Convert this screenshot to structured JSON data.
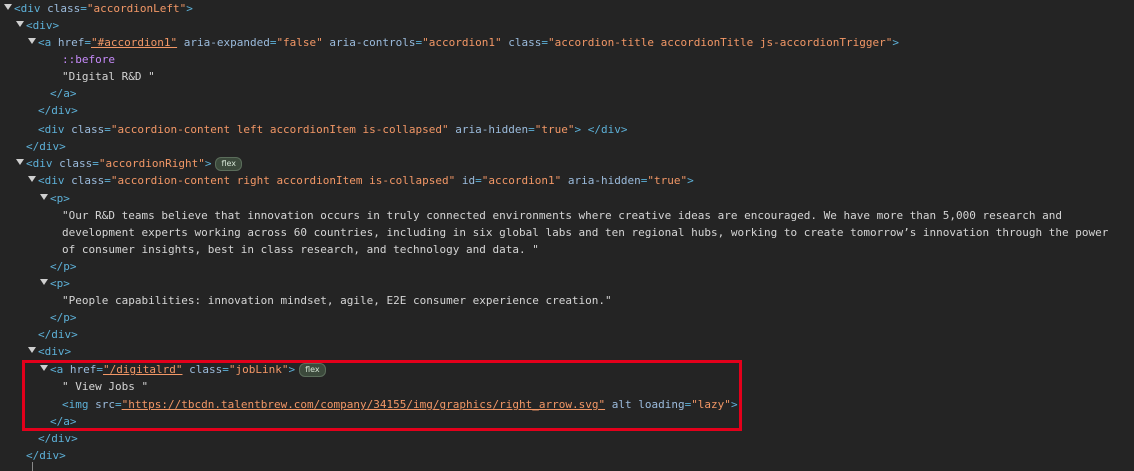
{
  "lines": {
    "l0": {
      "tag_open": "<div ",
      "a1": "class",
      "eq": "=",
      "v1": "\"accordionLeft\"",
      "close": ">"
    },
    "l1": {
      "text": "<div>"
    },
    "l2": {
      "tag_open": "<a ",
      "a1": "href",
      "v1": "\"#accordion1\"",
      "a2": "aria-expanded",
      "v2": "\"false\"",
      "a3": "aria-controls",
      "v3": "\"accordion1\"",
      "a4": "class",
      "v4": "\"accordion-title accordionTitle js-accordionTrigger\"",
      "close": ">"
    },
    "l3": {
      "text": "::before"
    },
    "l4": {
      "text": "\"Digital R&D \""
    },
    "l5": {
      "text": "</a>"
    },
    "l6": {
      "text": "</div>"
    },
    "l7": {
      "tag_open": "<div ",
      "a1": "class",
      "v1": "\"accordion-content left accordionItem is-collapsed\"",
      "a2": "aria-hidden",
      "v2": "\"true\"",
      "close": "> </div>"
    },
    "l8": {
      "text": "</div>"
    },
    "l9": {
      "tag_open": "<div ",
      "a1": "class",
      "v1": "\"accordionRight\"",
      "close": ">",
      "badge": "flex"
    },
    "l10": {
      "tag_open": "<div ",
      "a1": "class",
      "v1": "\"accordion-content right accordionItem is-collapsed\"",
      "a2": "id",
      "v2": "\"accordion1\"",
      "a3": "aria-hidden",
      "v3": "\"true\"",
      "close": ">"
    },
    "l11": {
      "text": "<p>"
    },
    "l12": {
      "text": "\"Our R&D teams believe that innovation occurs in truly connected environments where creative ideas are encouraged. We have more than 5,000 research and development experts working across 60 countries, including in six global labs and ten regional hubs, working to create tomorrow’s innovation through the power of consumer insights, best in class research, and technology and data. \""
    },
    "l13": {
      "text": "</p>"
    },
    "l14": {
      "text": "<p>"
    },
    "l15": {
      "text": "\"People capabilities: innovation mindset, agile, E2E consumer experience creation.\""
    },
    "l16": {
      "text": "</p>"
    },
    "l17": {
      "text": "</div>"
    },
    "l18": {
      "text": "<div>"
    },
    "l19": {
      "tag_open": "<a ",
      "a1": "href",
      "v1": "\"/digitalrd\"",
      "a2": "class",
      "v2": "\"jobLink\"",
      "close": ">",
      "badge": "flex"
    },
    "l20": {
      "text": "\" View Jobs \""
    },
    "l21": {
      "tag_open": "<img ",
      "a1": "src",
      "v1": "\"https://tbcdn.talentbrew.com/company/34155/img/graphics/right_arrow.svg\"",
      "a2": "alt",
      "a3": "loading",
      "v3": "\"lazy\"",
      "close": ">"
    },
    "l22": {
      "text": "</a>"
    },
    "l23": {
      "text": "</div>"
    },
    "l24": {
      "text": "</div>"
    }
  },
  "highlight_color": "#e3001b"
}
